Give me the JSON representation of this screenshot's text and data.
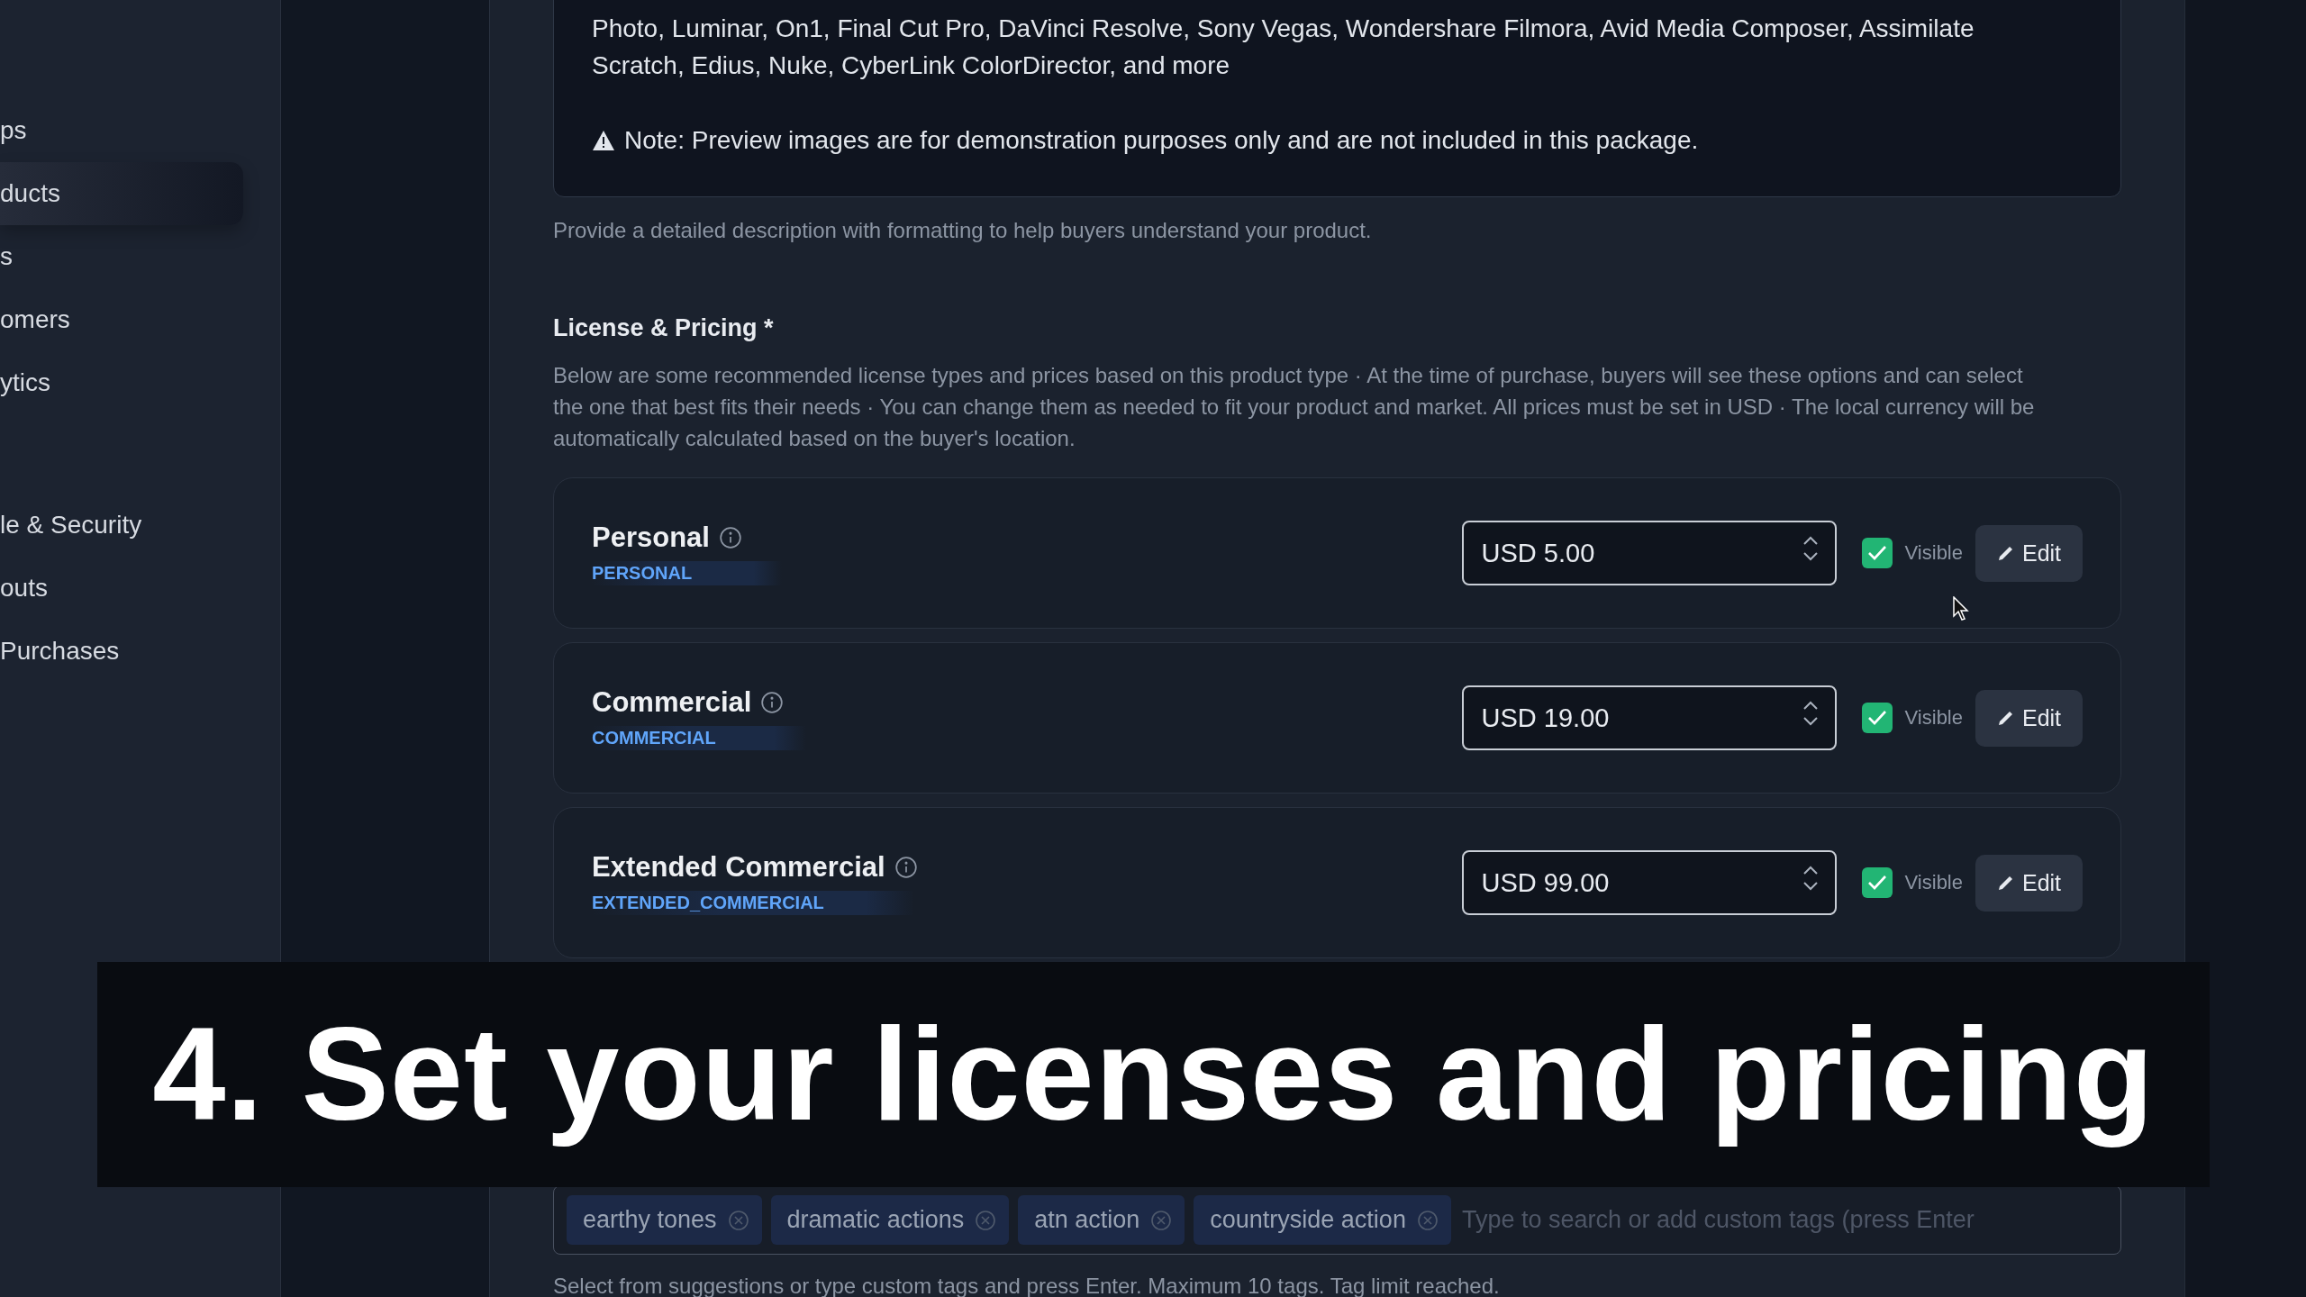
{
  "sidebar": {
    "items": [
      {
        "label": "ps",
        "selected": false
      },
      {
        "label": "ducts",
        "selected": true
      },
      {
        "label": "s",
        "selected": false
      },
      {
        "label": "omers",
        "selected": false
      },
      {
        "label": "ytics",
        "selected": false
      },
      {
        "label": "le & Security",
        "selected": false
      },
      {
        "label": "outs",
        "selected": false
      },
      {
        "label": "Purchases",
        "selected": false
      }
    ]
  },
  "description": {
    "text": "Photo, Luminar, On1, Final Cut Pro, DaVinci Resolve, Sony Vegas, Wondershare Filmora, Avid Media Composer, Assimilate Scratch, Edius, Nuke, CyberLink ColorDirector, and more",
    "note": "Note: Preview images are for demonstration purposes only and are not included in this package.",
    "helper": "Provide a detailed description with formatting to help buyers understand your product."
  },
  "license": {
    "title": "License & Pricing *",
    "intro": "Below are some recommended license types and prices based on this product type · At the time of purchase, buyers will see these options and can select the one that best fits their needs · You can change them as needed to fit your product and market. All prices must be set in USD · The local currency will be automatically calculated based on the buyer's location.",
    "items": [
      {
        "name": "Personal",
        "code": "PERSONAL",
        "price": "USD 5.00",
        "visible": true,
        "visible_label": "Visible",
        "edit": "Edit"
      },
      {
        "name": "Commercial",
        "code": "COMMERCIAL",
        "price": "USD 19.00",
        "visible": true,
        "visible_label": "Visible",
        "edit": "Edit"
      },
      {
        "name": "Extended Commercial",
        "code": "EXTENDED_COMMERCIAL",
        "price": "USD 99.00",
        "visible": true,
        "visible_label": "Visible",
        "edit": "Edit"
      }
    ]
  },
  "tags": {
    "rows": [
      [
        "earthy tones",
        "dramatic actions",
        "atn action",
        "countryside action"
      ]
    ],
    "placeholder": "Type to search or add custom tags (press Enter",
    "helper": "Select from suggestions or type custom tags and press Enter. Maximum 10 tags. Tag limit reached."
  },
  "caption": "4. Set your licenses and pricing"
}
